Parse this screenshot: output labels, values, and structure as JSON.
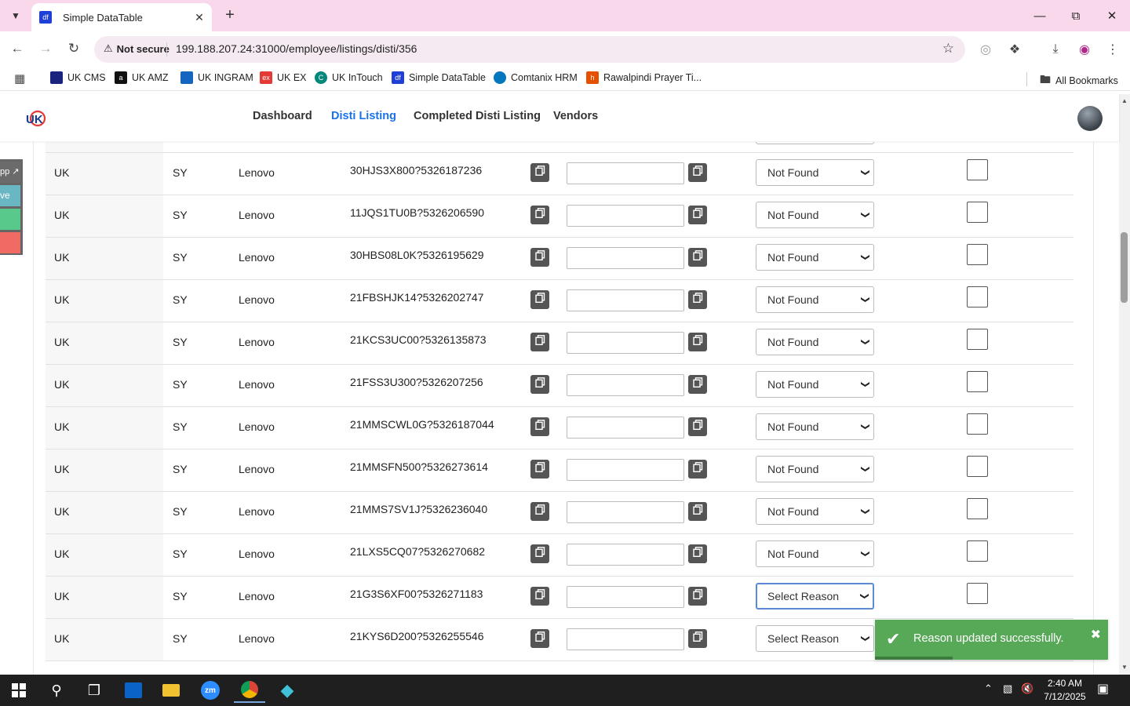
{
  "browser": {
    "tab_title": "Simple DataTable",
    "tab_icon_text": "df",
    "security_label": "Not secure",
    "url": "199.188.207.24:31000/employee/listings/disti/356",
    "bookmarks": [
      {
        "label": "UK CMS",
        "color": "#1a237e",
        "icon": "uk-cms-icon"
      },
      {
        "label": "UK AMZ",
        "color": "#111111",
        "icon": "amazon-icon"
      },
      {
        "label": "UK INGRAM",
        "color": "#1565c0",
        "icon": "ingram-icon"
      },
      {
        "label": "UK EX",
        "color": "#e53935",
        "icon": "ex-icon"
      },
      {
        "label": "UK InTouch",
        "color": "#00897b",
        "icon": "intouch-icon"
      },
      {
        "label": "Simple DataTable",
        "color": "#1e40d9",
        "icon": "datatable-icon"
      },
      {
        "label": "Comtanix HRM",
        "color": "#0277bd",
        "icon": "comtanix-icon"
      },
      {
        "label": "Rawalpindi Prayer Ti...",
        "color": "#e65100",
        "icon": "prayer-icon"
      }
    ],
    "all_bookmarks_label": "All Bookmarks"
  },
  "site": {
    "nav": [
      {
        "label": "Dashboard",
        "active": false
      },
      {
        "label": "Disti Listing",
        "active": true
      },
      {
        "label": "Completed Disti Listing",
        "active": false
      },
      {
        "label": "Vendors",
        "active": false
      }
    ],
    "side_tabs": [
      {
        "label": "pp ↗",
        "color": "#6b6b6b"
      },
      {
        "label": "ve",
        "color": "#6ab7c4"
      },
      {
        "label": "",
        "color": "#58c98a"
      },
      {
        "label": "",
        "color": "#ef6b63"
      }
    ]
  },
  "table": {
    "rows": [
      {
        "country": "UK",
        "code": "SY",
        "brand": "Lenovo",
        "part": "30HJS3X800?5326187236",
        "reason": "Not Found",
        "focused": false
      },
      {
        "country": "UK",
        "code": "SY",
        "brand": "Lenovo",
        "part": "11JQS1TU0B?5326206590",
        "reason": "Not Found",
        "focused": false
      },
      {
        "country": "UK",
        "code": "SY",
        "brand": "Lenovo",
        "part": "30HBS08L0K?5326195629",
        "reason": "Not Found",
        "focused": false
      },
      {
        "country": "UK",
        "code": "SY",
        "brand": "Lenovo",
        "part": "21FBSHJK14?5326202747",
        "reason": "Not Found",
        "focused": false
      },
      {
        "country": "UK",
        "code": "SY",
        "brand": "Lenovo",
        "part": "21KCS3UC00?5326135873",
        "reason": "Not Found",
        "focused": false
      },
      {
        "country": "UK",
        "code": "SY",
        "brand": "Lenovo",
        "part": "21FSS3U300?5326207256",
        "reason": "Not Found",
        "focused": false
      },
      {
        "country": "UK",
        "code": "SY",
        "brand": "Lenovo",
        "part": "21MMSCWL0G?5326187044",
        "reason": "Not Found",
        "focused": false
      },
      {
        "country": "UK",
        "code": "SY",
        "brand": "Lenovo",
        "part": "21MMSFN500?5326273614",
        "reason": "Not Found",
        "focused": false
      },
      {
        "country": "UK",
        "code": "SY",
        "brand": "Lenovo",
        "part": "21MMS7SV1J?5326236040",
        "reason": "Not Found",
        "focused": false
      },
      {
        "country": "UK",
        "code": "SY",
        "brand": "Lenovo",
        "part": "21LXS5CQ07?5326270682",
        "reason": "Not Found",
        "focused": false
      },
      {
        "country": "UK",
        "code": "SY",
        "brand": "Lenovo",
        "part": "21G3S6XF00?5326271183",
        "reason": "Select Reason",
        "focused": true
      },
      {
        "country": "UK",
        "code": "SY",
        "brand": "Lenovo",
        "part": "21KYS6D200?5326255546",
        "reason": "Select Reason",
        "focused": false
      }
    ]
  },
  "toast": {
    "message": "Reason updated successfully.",
    "color": "#57a857"
  },
  "taskbar": {
    "time": "2:40 AM",
    "date": "7/12/2025",
    "notification_count": "1"
  }
}
